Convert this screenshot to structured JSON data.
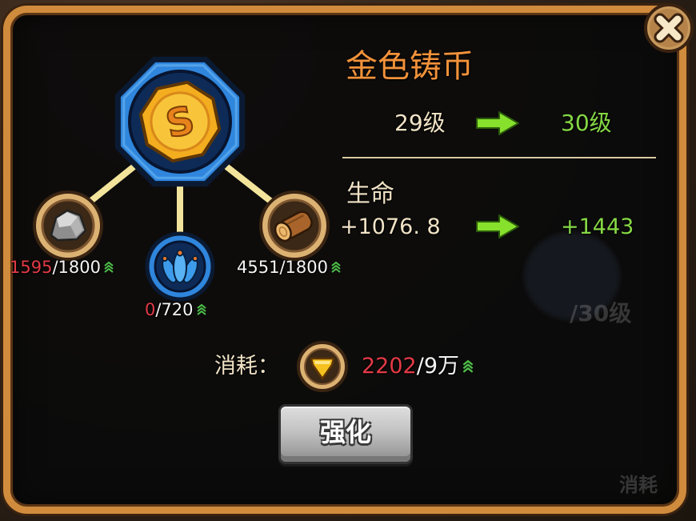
{
  "dialog": {
    "title": "金色铸币",
    "close_button": {
      "icon": "close-icon"
    },
    "main_item": {
      "icon": "gold-coin-icon",
      "symbol": "S"
    },
    "materials": [
      {
        "icon": "stone-icon",
        "have": "1595",
        "need": "/1800"
      },
      {
        "icon": "blue-scale-icon",
        "have": "0",
        "need": "/720"
      },
      {
        "icon": "wood-log-icon",
        "have": "4551",
        "need": "/1800"
      }
    ],
    "level": {
      "current": "29级",
      "next": "30级"
    },
    "stat": {
      "label": "生命",
      "current": "+1076. 8",
      "next": "+1443"
    },
    "cost": {
      "label": "消耗：",
      "icon": "gold-crest-icon",
      "have": "2202",
      "need": "/9万"
    },
    "upgrade_button": {
      "label": "强化"
    },
    "arrow_icon": "right-arrow-icon",
    "more_icon": "upgrade-arrows-icon"
  },
  "background": {
    "level_text": "/30级",
    "cost_text": "消耗"
  },
  "colors": {
    "title": "#f2923a",
    "upgrade_green": "#86d845",
    "insufficient_red": "#e23a46",
    "panel_border": "#d08b3d",
    "badge_blue": "#2f86dc",
    "button_grey": "#b4b4b4"
  }
}
